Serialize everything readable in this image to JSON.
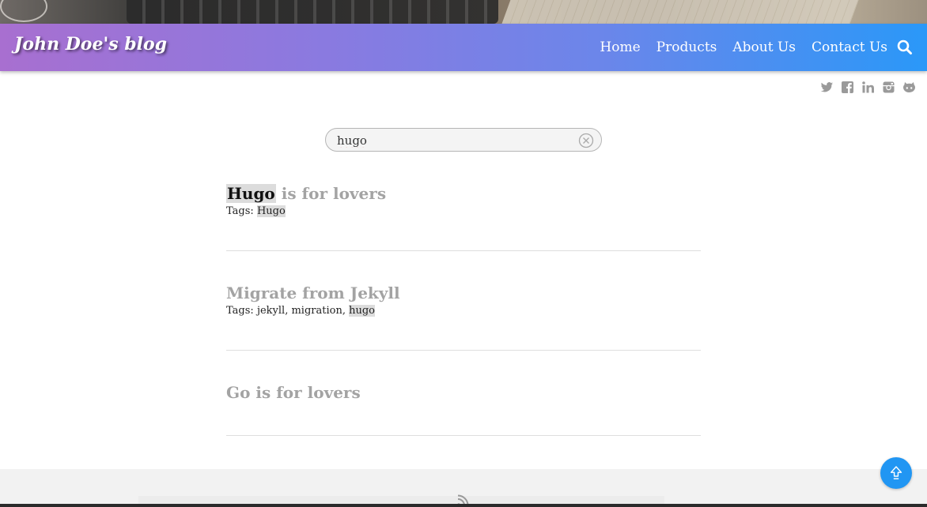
{
  "site": {
    "brand": "John Doe's blog",
    "nav": [
      "Home",
      "Products",
      "About Us",
      "Contact Us"
    ],
    "search_icon": "search-icon",
    "social_icons": [
      "twitter-icon",
      "facebook-icon",
      "linkedin-icon",
      "instagram-icon",
      "github-icon"
    ]
  },
  "search": {
    "query": "hugo",
    "clear_icon": "clear-icon"
  },
  "results": [
    {
      "title_mark": "Hugo",
      "title_rest": " is for lovers",
      "tags_label": "Tags:",
      "tags": [
        "Hugo"
      ],
      "highlighted_tag": "Hugo"
    },
    {
      "title": "Migrate from Jekyll",
      "tags_label": "Tags:",
      "tags": [
        "jekyll",
        "migration",
        "hugo"
      ],
      "highlighted_tag": "hugo"
    },
    {
      "title": "Go is for lovers"
    }
  ],
  "footer": {
    "rss_icon": "rss-icon",
    "to_top_icon": "arrow-up-icon"
  },
  "colors": {
    "nav_gradient_start": "#a86fd0",
    "nav_gradient_end": "#2a98f8",
    "result_title": "#a3a3a3",
    "highlight": "#dcdcdc",
    "to_top_button": "#2196f3"
  }
}
